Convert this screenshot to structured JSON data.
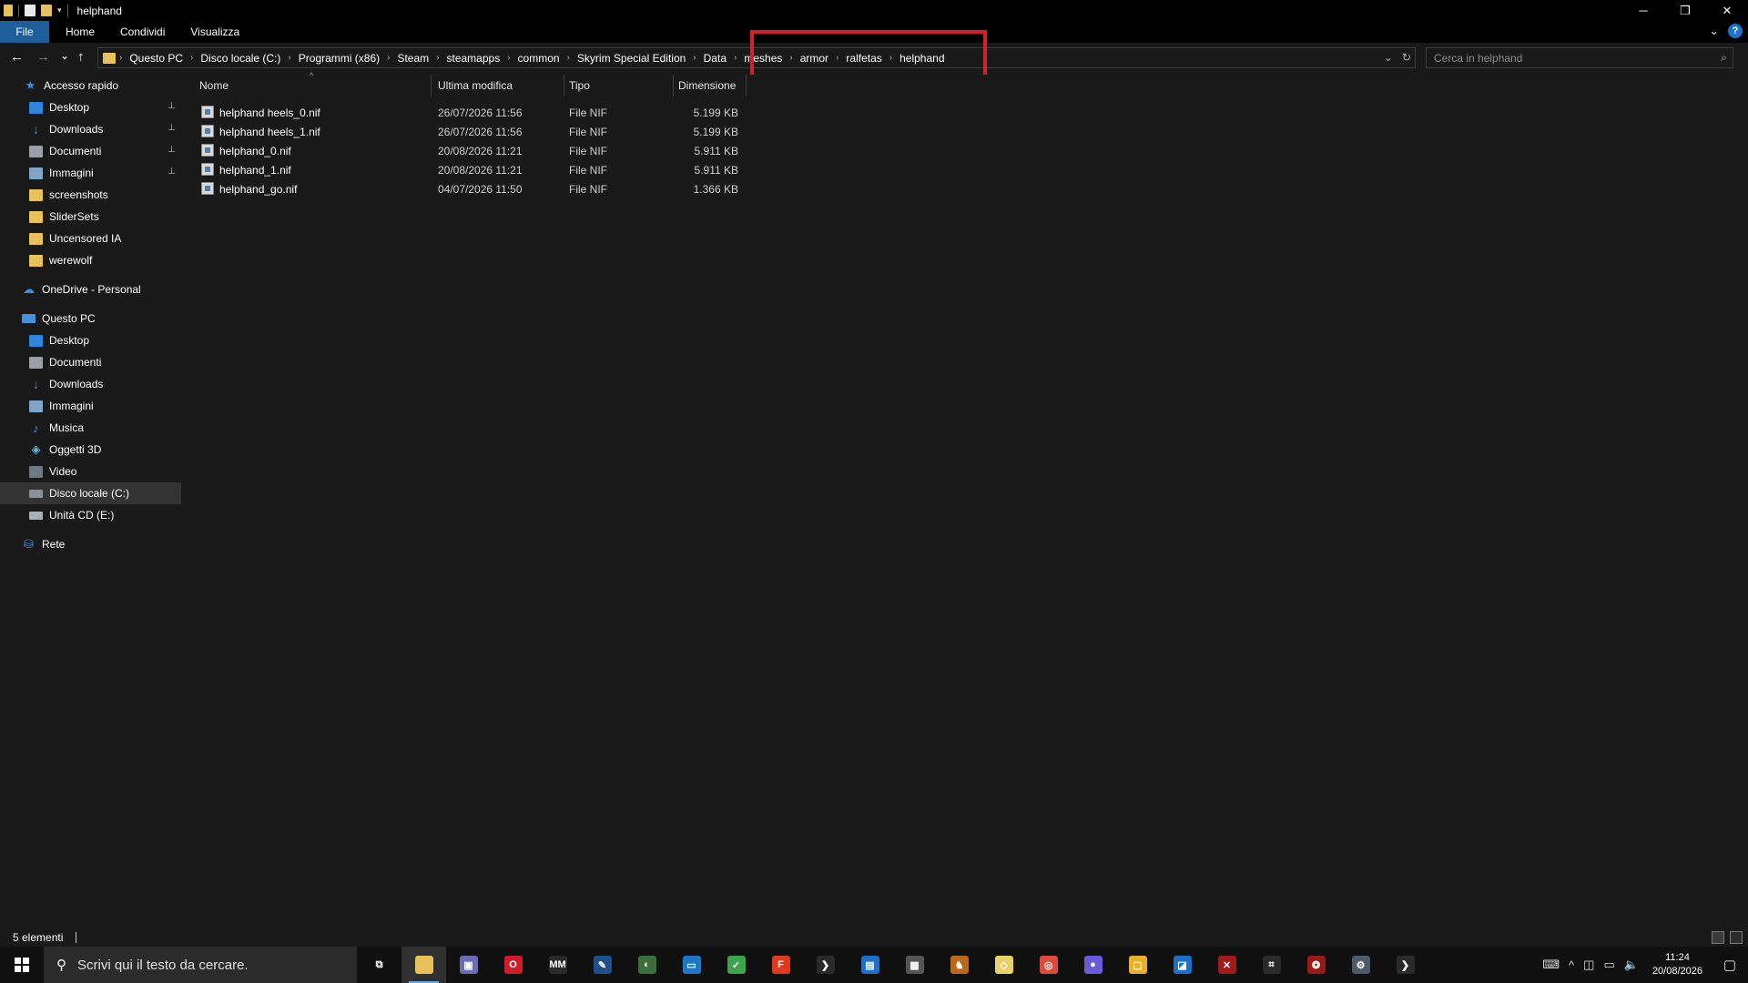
{
  "window": {
    "title": "helphand",
    "controls": {
      "minimize": "─",
      "restore": "❐",
      "close": "✕"
    }
  },
  "ribbon": {
    "tabs": [
      "File",
      "Home",
      "Condividi",
      "Visualizza"
    ],
    "expand_icon": "chevron-down-icon",
    "help_label": "?"
  },
  "nav": {
    "back": "←",
    "forward": "→",
    "recent": "⌄",
    "up": "↑"
  },
  "address": {
    "breadcrumb": [
      "Questo PC",
      "Disco locale (C:)",
      "Programmi (x86)",
      "Steam",
      "steamapps",
      "common",
      "Skyrim Special Edition",
      "Data",
      "meshes",
      "armor",
      "ralfetas",
      "helphand"
    ],
    "separator": "›",
    "dropdown": "⌄",
    "refresh": "↻"
  },
  "search": {
    "placeholder": "Cerca in helphand",
    "icon": "⌕"
  },
  "sidebar": {
    "quick_access": {
      "label": "Accesso rapido",
      "items": [
        {
          "label": "Desktop",
          "icon": "desktop-icon",
          "pinned": true
        },
        {
          "label": "Downloads",
          "icon": "download-icon",
          "pinned": true
        },
        {
          "label": "Documenti",
          "icon": "documents-icon",
          "pinned": true
        },
        {
          "label": "Immagini",
          "icon": "pictures-icon",
          "pinned": true
        },
        {
          "label": "screenshots",
          "icon": "folder-icon",
          "pinned": false
        },
        {
          "label": "SliderSets",
          "icon": "folder-icon",
          "pinned": false
        },
        {
          "label": "Uncensored IA",
          "icon": "folder-icon",
          "pinned": false
        },
        {
          "label": "werewolf",
          "icon": "folder-icon",
          "pinned": false
        }
      ]
    },
    "onedrive": {
      "label": "OneDrive - Personal"
    },
    "this_pc": {
      "label": "Questo PC",
      "items": [
        {
          "label": "Desktop",
          "icon": "desktop-icon"
        },
        {
          "label": "Documenti",
          "icon": "documents-icon"
        },
        {
          "label": "Downloads",
          "icon": "download-icon"
        },
        {
          "label": "Immagini",
          "icon": "pictures-icon"
        },
        {
          "label": "Musica",
          "icon": "music-icon"
        },
        {
          "label": "Oggetti 3D",
          "icon": "cube-icon"
        },
        {
          "label": "Video",
          "icon": "video-icon"
        },
        {
          "label": "Disco locale (C:)",
          "icon": "drive-icon",
          "selected": true
        },
        {
          "label": "Unità CD (E:)",
          "icon": "cd-drive-icon"
        }
      ]
    },
    "network": {
      "label": "Rete"
    },
    "pin_glyph": "📌"
  },
  "columns": [
    "Nome",
    "Ultima modifica",
    "Tipo",
    "Dimensione"
  ],
  "sort_glyph": "^",
  "files": [
    {
      "name": "helphand heels_0.nif",
      "modified": "26/07/2026 11:56",
      "type": "File NIF",
      "size": "5.199 KB"
    },
    {
      "name": "helphand heels_1.nif",
      "modified": "26/07/2026 11:56",
      "type": "File NIF",
      "size": "5.199 KB"
    },
    {
      "name": "helphand_0.nif",
      "modified": "20/08/2026 11:21",
      "type": "File NIF",
      "size": "5.911 KB"
    },
    {
      "name": "helphand_1.nif",
      "modified": "20/08/2026 11:21",
      "type": "File NIF",
      "size": "5.911 KB"
    },
    {
      "name": "helphand_go.nif",
      "modified": "04/07/2026 11:50",
      "type": "File NIF",
      "size": "1.366 KB"
    }
  ],
  "status": {
    "count": "5 elementi"
  },
  "taskbar": {
    "search_placeholder": "Scrivi qui il testo da cercare.",
    "apps": [
      {
        "name": "task-view-icon",
        "color": "#101010",
        "glyph": "⧉"
      },
      {
        "name": "file-explorer-icon",
        "color": "#e8c15a",
        "glyph": "",
        "active": true
      },
      {
        "name": "app-icon-1",
        "color": "#6b6bb5",
        "glyph": "▣"
      },
      {
        "name": "opera-icon",
        "color": "#d11a2a",
        "glyph": "O"
      },
      {
        "name": "app-icon-2",
        "color": "#2a2a2a",
        "glyph": "MM"
      },
      {
        "name": "app-icon-3",
        "color": "#1f4f8a",
        "glyph": "✎"
      },
      {
        "name": "app-icon-4",
        "color": "#3b6e3b",
        "glyph": "◐"
      },
      {
        "name": "app-icon-5",
        "color": "#1e78c8",
        "glyph": "▭"
      },
      {
        "name": "app-icon-6",
        "color": "#3fa34d",
        "glyph": "✓"
      },
      {
        "name": "app-icon-7",
        "color": "#e03a1e",
        "glyph": "F"
      },
      {
        "name": "app-icon-8",
        "color": "#2a2a2a",
        "glyph": "❯"
      },
      {
        "name": "app-icon-9",
        "color": "#1e6fc8",
        "glyph": "▤"
      },
      {
        "name": "app-icon-10",
        "color": "#555",
        "glyph": "▦"
      },
      {
        "name": "app-icon-11",
        "color": "#b86a1a",
        "glyph": "♞"
      },
      {
        "name": "app-icon-12",
        "color": "#e8d06a",
        "glyph": "◇"
      },
      {
        "name": "chrome-icon",
        "color": "#e04a3a",
        "glyph": "◎"
      },
      {
        "name": "app-icon-13",
        "color": "#6a5ad8",
        "glyph": "●"
      },
      {
        "name": "app-icon-14",
        "color": "#e8b02a",
        "glyph": "▢"
      },
      {
        "name": "app-icon-15",
        "color": "#1e6fc8",
        "glyph": "◪"
      },
      {
        "name": "app-icon-16",
        "color": "#a01a1a",
        "glyph": "✕"
      },
      {
        "name": "app-icon-17",
        "color": "#2a2a2a",
        "glyph": "⌗"
      },
      {
        "name": "app-icon-18",
        "color": "#9a1a1a",
        "glyph": "❂"
      },
      {
        "name": "app-icon-19",
        "color": "#4a5a6a",
        "glyph": "⚙"
      },
      {
        "name": "app-icon-20",
        "color": "#2a2a2a",
        "glyph": "❯"
      }
    ],
    "tray_up": "^",
    "time": "11:24",
    "date": "20/08/2026"
  },
  "colors": {
    "accent": "#1d5f9b",
    "highlight_box": "#d3212a",
    "background": "#191919"
  }
}
